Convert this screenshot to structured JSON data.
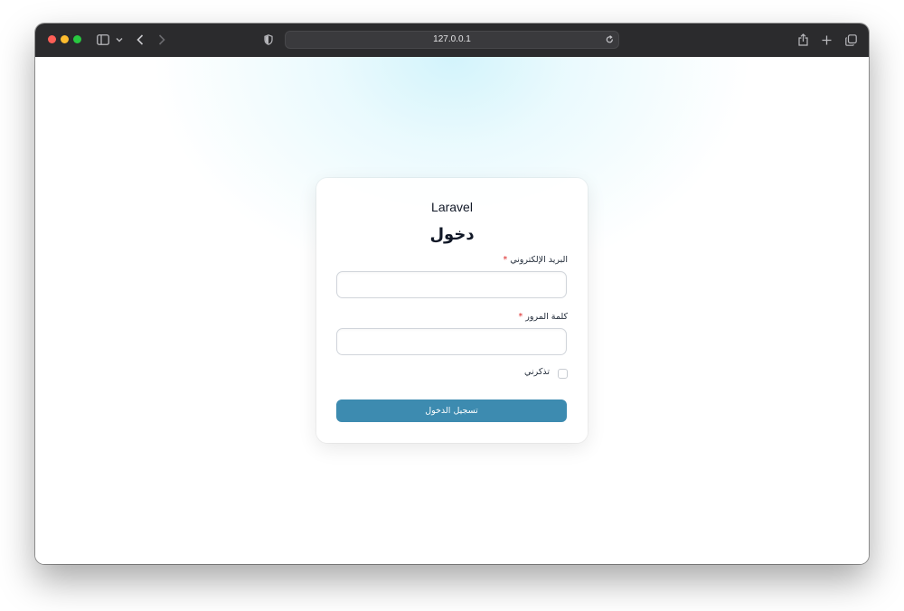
{
  "browser": {
    "url": "127.0.0.1",
    "traffic_colors": {
      "close": "#ff5f57",
      "minimize": "#febc2e",
      "zoom": "#28c840"
    },
    "icons": [
      "sidebar-icon",
      "chevron-down-icon",
      "back-icon",
      "forward-icon",
      "shield-icon",
      "reload-icon",
      "share-icon",
      "new-tab-icon",
      "tabs-overview-icon"
    ]
  },
  "login": {
    "brand": "Laravel",
    "heading": "دخول",
    "email_label": "البريد الإلكتروني",
    "password_label": "كلمة المرور",
    "required_mark": "*",
    "remember_label": "تذكرني",
    "submit_label": "تسجيل الدخول",
    "accent_color": "#3d8bb0"
  }
}
